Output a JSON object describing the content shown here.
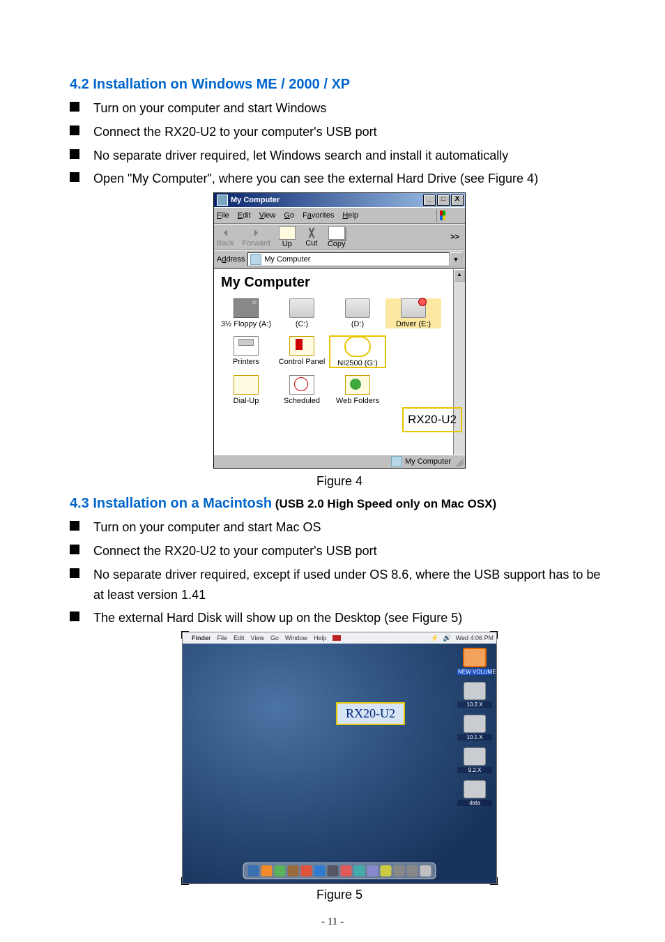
{
  "section42": {
    "heading": "4.2 Installation on Windows ME / 2000 / XP",
    "bullets": [
      "Turn on your computer and start Windows",
      "Connect the RX20-U2 to your computer's USB port",
      "No separate driver required, let Windows search and install it automatically",
      "Open \"My Computer\", where you can see the external Hard Drive (see Figure 4)"
    ]
  },
  "figure4": {
    "caption": "Figure 4",
    "title": "My Computer",
    "menu": {
      "file": "File",
      "edit": "Edit",
      "view": "View",
      "go": "Go",
      "fav": "Favorites",
      "help": "Help"
    },
    "toolbar": {
      "back": "Back",
      "forward": "Forward",
      "up": "Up",
      "cut": "Cut",
      "copy": "Copy",
      "chev": ">>"
    },
    "address": {
      "label": "Address",
      "value": "My Computer"
    },
    "header": "My Computer",
    "icons": {
      "floppy": "3½ Floppy (A:)",
      "c": "(C:)",
      "d": "(D:)",
      "e": "Driver (E:)",
      "printers": "Printers",
      "cpanel": "Control Panel",
      "net": "NI2500 (G:)",
      "dial": "Dial-Up",
      "sched": "Scheduled",
      "web": "Web Folders"
    },
    "callout": "RX20-U2",
    "status": "My Computer"
  },
  "section43": {
    "heading": "4.3 Installation on a Macintosh",
    "subheading": " (USB 2.0 High Speed only on Mac OSX)",
    "bullets": [
      "Turn on your computer and start Mac OS",
      "Connect the RX20-U2 to your computer's USB port",
      "No separate driver required, except if used under OS 8.6, where the USB support has to be at least version 1.41",
      "The external Hard Disk will show up on the Desktop (see Figure 5)"
    ]
  },
  "figure5": {
    "caption": "Figure 5",
    "menubar": {
      "finder": "Finder",
      "file": "File",
      "edit": "Edit",
      "view": "View",
      "go": "Go",
      "window": "Window",
      "help": "Help",
      "time": "Wed 4:06 PM"
    },
    "newvol": "NEW VOLUME",
    "drives": [
      "10.2.X",
      "10.1.X",
      "9.2.X",
      "data"
    ],
    "callout": "RX20-U2",
    "dock_colors": [
      "#3a6fb0",
      "#f08a2a",
      "#5ab35a",
      "#9a6b3c",
      "#e0533d",
      "#2f7bcf",
      "#556",
      "#e05a5a",
      "#4aa",
      "#88c",
      "#cc4",
      "#888",
      "#888",
      "#c0c0c0"
    ]
  },
  "page_number": "- 11 -"
}
